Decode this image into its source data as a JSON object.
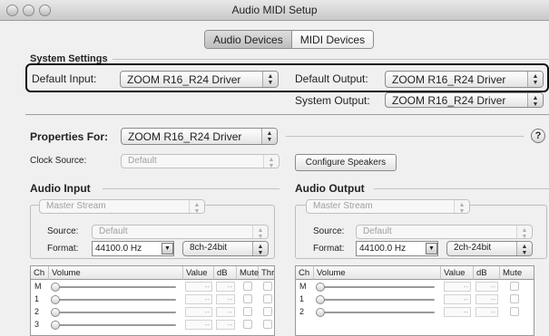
{
  "window": {
    "title": "Audio MIDI Setup"
  },
  "tabs": [
    {
      "label": "Audio Devices",
      "selected": true
    },
    {
      "label": "MIDI Devices",
      "selected": false
    }
  ],
  "system_settings": {
    "title": "System Settings",
    "default_input_label": "Default Input:",
    "default_input_value": "ZOOM R16_R24 Driver",
    "default_output_label": "Default Output:",
    "default_output_value": "ZOOM R16_R24 Driver",
    "system_output_label": "System Output:",
    "system_output_value": "ZOOM R16_R24 Driver"
  },
  "properties": {
    "label": "Properties For:",
    "value": "ZOOM R16_R24 Driver",
    "help_glyph": "?",
    "clock_source_label": "Clock Source:",
    "clock_source_value": "Default",
    "configure_speakers_label": "Configure Speakers"
  },
  "audio_input": {
    "title": "Audio Input",
    "stream": "Master Stream",
    "source_label": "Source:",
    "source_value": "Default",
    "format_label": "Format:",
    "format_rate": "44100.0 Hz",
    "format_bits": "8ch-24bit",
    "columns": [
      "Ch",
      "Volume",
      "Value",
      "dB",
      "Mute",
      "Thru"
    ],
    "rows": [
      {
        "ch": "M",
        "value": "--",
        "db": "--"
      },
      {
        "ch": "1",
        "value": "--",
        "db": "--"
      },
      {
        "ch": "2",
        "value": "--",
        "db": "--"
      },
      {
        "ch": "3",
        "value": "--",
        "db": "--"
      }
    ]
  },
  "audio_output": {
    "title": "Audio Output",
    "stream": "Master Stream",
    "source_label": "Source:",
    "source_value": "Default",
    "format_label": "Format:",
    "format_rate": "44100.0 Hz",
    "format_bits": "2ch-24bit",
    "columns": [
      "Ch",
      "Volume",
      "Value",
      "dB",
      "Mute"
    ],
    "rows": [
      {
        "ch": "M",
        "value": "--",
        "db": "--"
      },
      {
        "ch": "1",
        "value": "--",
        "db": "--"
      },
      {
        "ch": "2",
        "value": "--",
        "db": "--"
      }
    ]
  },
  "icons": {
    "popup_arrows": "up-down-arrows-icon",
    "combo_arrow": "chevron-down-icon",
    "help": "help-icon"
  }
}
